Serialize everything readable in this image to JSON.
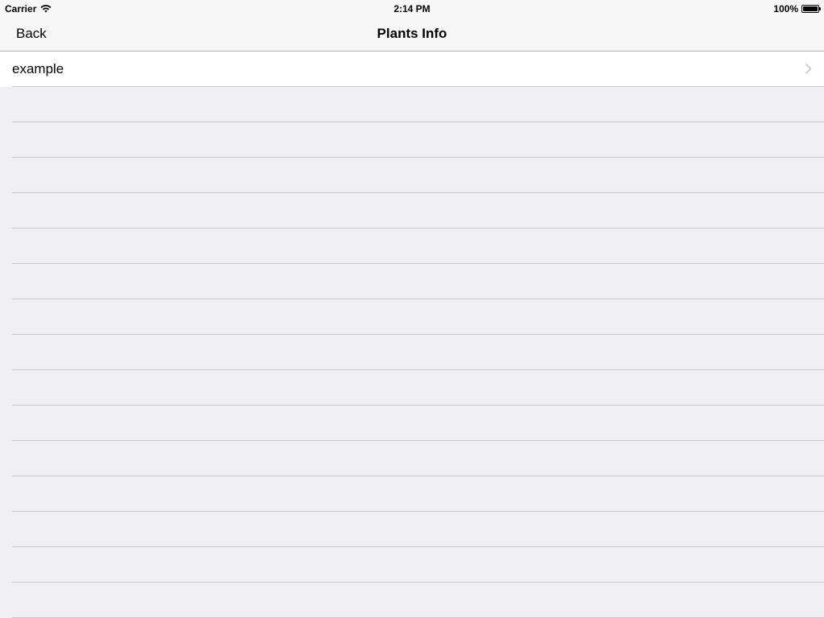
{
  "status_bar": {
    "carrier": "Carrier",
    "time": "2:14 PM",
    "battery_percent": "100%",
    "battery_level": 1.0,
    "wifi_icon": "wifi-icon",
    "battery_icon": "battery-icon"
  },
  "nav": {
    "back_label": "Back",
    "title": "Plants Info"
  },
  "table": {
    "rows": [
      {
        "label": "example",
        "accessory_icon": "chevron-right-icon"
      }
    ]
  },
  "colors": {
    "background": "#efeff4",
    "separator": "#c8c7cc",
    "bar_background": "#f7f7f7",
    "cell_background": "#ffffff",
    "chevron": "#c7c7cc"
  }
}
